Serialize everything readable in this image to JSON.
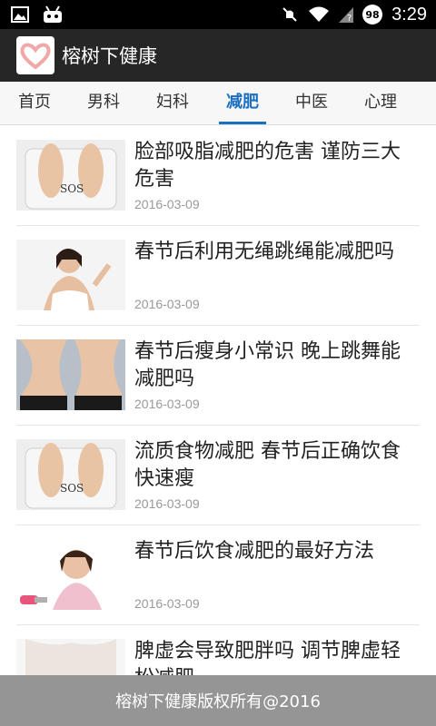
{
  "status_bar": {
    "time": "3:29",
    "battery_level": "98",
    "icons": [
      "image-icon",
      "android-icon",
      "mute-icon",
      "wifi-icon",
      "no-signal-icon"
    ]
  },
  "app": {
    "title": "榕树下健康",
    "logo_icon": "heart-hands-logo"
  },
  "tabs": [
    {
      "label": "首页",
      "active": false
    },
    {
      "label": "男科",
      "active": false
    },
    {
      "label": "妇科",
      "active": false
    },
    {
      "label": "减肥",
      "active": true
    },
    {
      "label": "中医",
      "active": false
    },
    {
      "label": "心理",
      "active": false
    }
  ],
  "articles": [
    {
      "title": "脸部吸脂减肥的危害 谨防三大危害",
      "date": "2016-03-09",
      "thumb": "scale-feet"
    },
    {
      "title": "春节后利用无绳跳绳能减肥吗",
      "date": "2016-03-09",
      "thumb": "woman-stretching"
    },
    {
      "title": "春节后瘦身小常识 晚上跳舞能减肥吗",
      "date": "2016-03-09",
      "thumb": "waist-comparison"
    },
    {
      "title": "流质食物减肥 春节后正确饮食快速瘦",
      "date": "2016-03-09",
      "thumb": "scale-feet"
    },
    {
      "title": "春节后饮食减肥的最好方法",
      "date": "2016-03-09",
      "thumb": "woman-dumbbell"
    },
    {
      "title": "脾虚会导致肥胖吗 调节脾虚轻松减肥",
      "date": "",
      "thumb": "body-white"
    }
  ],
  "footer": {
    "text": "榕树下健康版权所有@2016"
  },
  "colors": {
    "accent": "#1a6fc0",
    "app_bar": "#262626",
    "status_bar": "#000000",
    "footer": "#8c8c8c"
  }
}
